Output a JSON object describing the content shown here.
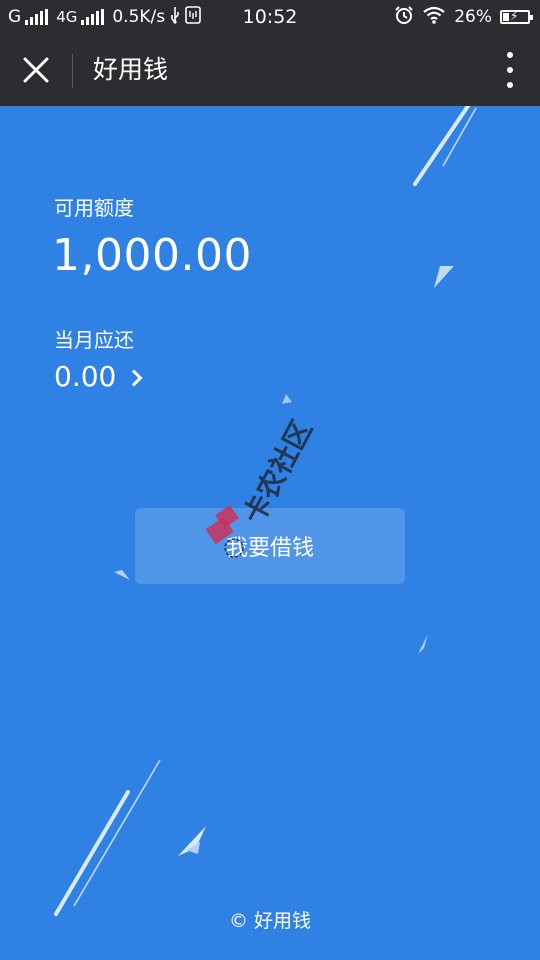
{
  "status_bar": {
    "carrier1": "G",
    "carrier2": "4G",
    "speed": "0.5K/s",
    "time": "10:52",
    "battery": "26%",
    "battery_level": 0.26
  },
  "header": {
    "title": "好用钱"
  },
  "credit": {
    "available_label": "可用额度",
    "available_amount": "1,000.00",
    "due_label": "当月应还",
    "due_amount": "0.00"
  },
  "actions": {
    "borrow_label": "我要借钱"
  },
  "watermark": {
    "text": "卡农社区"
  },
  "footer": {
    "copyright": "© 好用钱"
  },
  "colors": {
    "bar_bg": "#2b2d30",
    "main_bg": "#2f82e4",
    "text": "#ffffff"
  }
}
